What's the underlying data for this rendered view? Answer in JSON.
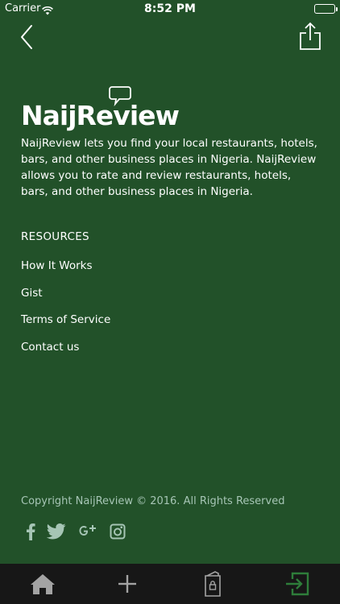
{
  "status_bar": {
    "carrier": "Carrier",
    "time": "8:52 PM",
    "battery_level": 1.0
  },
  "nav": {
    "back_icon": "chevron-left-icon",
    "share_icon": "share-icon"
  },
  "logo": {
    "text": "NaijReview",
    "icon": "speech-bubble-icon"
  },
  "intro_text": "NaijReview lets you find your local restaurants, hotels, bars, and other business places in Nigeria. NaijReview allows you to rate and review restaurants, hotels, bars, and other business places in Nigeria.",
  "resources": {
    "heading": "RESOURCES",
    "links": [
      "How It Works",
      "Gist",
      "Terms of Service",
      "Contact us"
    ]
  },
  "copyright": "Copyright NaijReview © 2016. All Rights Reserved",
  "social_icons": [
    "facebook-icon",
    "twitter-icon",
    "google-plus-icon",
    "instagram-icon"
  ],
  "tab_bar": {
    "tabs": [
      "home-icon",
      "plus-icon",
      "locked-book-icon",
      "sign-in-icon"
    ],
    "active_index": 3
  },
  "colors": {
    "background": "#225129",
    "tab_bar": "#171717",
    "tab_icon": "#a3a3a3",
    "tab_active": "#2e7d3a",
    "copyright": "#a6c5b5"
  }
}
